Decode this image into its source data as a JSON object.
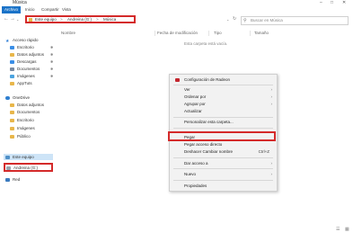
{
  "window": {
    "title": "Música"
  },
  "ribbon": {
    "tabs": [
      "Archivo",
      "Inicio",
      "Compartir",
      "Vista"
    ]
  },
  "address": {
    "crumbs": [
      "Este equipo",
      ">",
      "Andreina (G:)",
      ">",
      "Música"
    ]
  },
  "search": {
    "placeholder": "Buscar en Música"
  },
  "columns": [
    "Nombre",
    "Fecha de modificación",
    "Tipo",
    "Tamaño"
  ],
  "empty_message": "Esta carpeta está vacía.",
  "sidebar": {
    "quick_access": "Acceso rápido",
    "quick_items": [
      "Escritorio",
      "Datos adjuntos",
      "Descargas",
      "Documentos",
      "Imágenes",
      "AppTuts"
    ],
    "onedrive": "OneDrive",
    "onedrive_items": [
      "Datos adjuntos",
      "Documentos",
      "Escritorio",
      "Imágenes",
      "Público"
    ],
    "this_pc": "Este equipo",
    "drive": "Andreina (G:)",
    "network": "Red"
  },
  "context_menu": {
    "header": "Configuración de Radeon",
    "items": [
      {
        "label": "Ver",
        "submenu": true
      },
      {
        "label": "Ordenar por",
        "submenu": true
      },
      {
        "label": "Agrupar por",
        "submenu": true
      },
      {
        "label": "Actualizar"
      },
      {
        "label": "Personalizar esta carpeta..."
      },
      {
        "label": "Pegar"
      },
      {
        "label": "Pegar acceso directo"
      },
      {
        "label": "Deshacer Cambiar nombre",
        "shortcut": "Ctrl+Z"
      },
      {
        "label": "Dar acceso a",
        "submenu": true
      },
      {
        "label": "Nuevo",
        "submenu": true
      },
      {
        "label": "Propiedades"
      }
    ]
  },
  "colors": {
    "accent": "#1a73c8",
    "highlight": "#d42a2a"
  }
}
